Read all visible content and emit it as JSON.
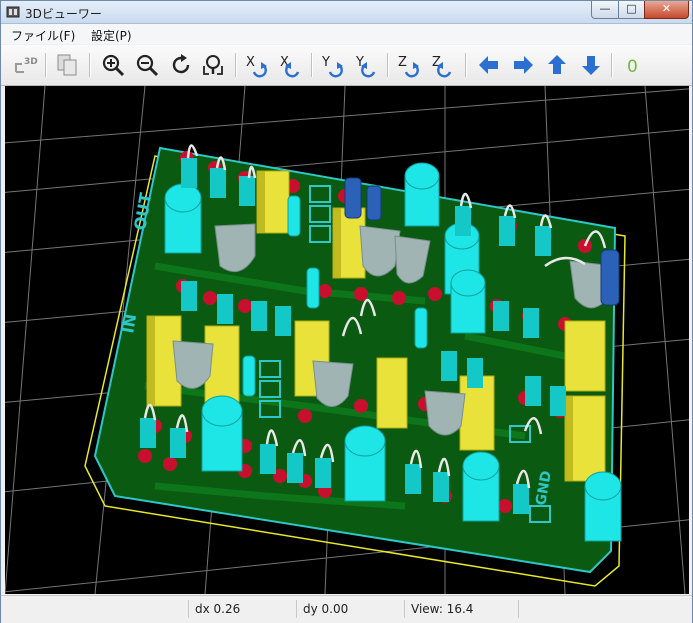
{
  "window": {
    "title": "3Dビューワー"
  },
  "window_buttons": {
    "minimize": "—",
    "maximize": "□",
    "close": "✕"
  },
  "menu": {
    "items": [
      "ファイル(F)",
      "設定(P)"
    ]
  },
  "toolbar": {
    "buttons": [
      {
        "name": "reload-3d-button",
        "icon": "3d-refresh-icon",
        "text": "3D"
      },
      {
        "name": "copy-image-button",
        "icon": "copy-icon"
      },
      {
        "name": "zoom-in-button",
        "icon": "zoom-in-icon"
      },
      {
        "name": "zoom-out-button",
        "icon": "zoom-out-icon"
      },
      {
        "name": "redraw-button",
        "icon": "redraw-icon"
      },
      {
        "name": "zoom-fit-button",
        "icon": "zoom-fit-icon"
      },
      {
        "name": "rotate-x-cw-button",
        "icon": "rotate-x-icon",
        "text": "X"
      },
      {
        "name": "rotate-x-ccw-button",
        "icon": "rotate-x-icon",
        "text": "X"
      },
      {
        "name": "rotate-y-cw-button",
        "icon": "rotate-y-icon",
        "text": "Y"
      },
      {
        "name": "rotate-y-ccw-button",
        "icon": "rotate-y-icon",
        "text": "Y"
      },
      {
        "name": "rotate-z-cw-button",
        "icon": "rotate-z-icon",
        "text": "Z"
      },
      {
        "name": "rotate-z-ccw-button",
        "icon": "rotate-z-icon",
        "text": "Z"
      },
      {
        "name": "pan-left-button",
        "icon": "arrow-left-icon"
      },
      {
        "name": "pan-right-button",
        "icon": "arrow-right-icon"
      },
      {
        "name": "pan-up-button",
        "icon": "arrow-up-icon"
      },
      {
        "name": "pan-down-button",
        "icon": "arrow-down-icon"
      },
      {
        "name": "ortho-toggle-button",
        "icon": "ortho-icon",
        "text": "0"
      }
    ]
  },
  "board": {
    "silkscreen_labels": [
      "OUT",
      "IN",
      "GND"
    ],
    "colors": {
      "background": "#000000",
      "pcb": "#0b5a12",
      "pad": "#c8102e",
      "silk": "#2ec6c6",
      "capacitor": "#1ee6e6",
      "film_cap": "#e8e23a",
      "transistor": "#a0b4b4",
      "outline": "#e8e82a"
    }
  },
  "status": {
    "dx": "dx 0.26",
    "dy": "dy 0.00",
    "view": "View: 16.4"
  }
}
